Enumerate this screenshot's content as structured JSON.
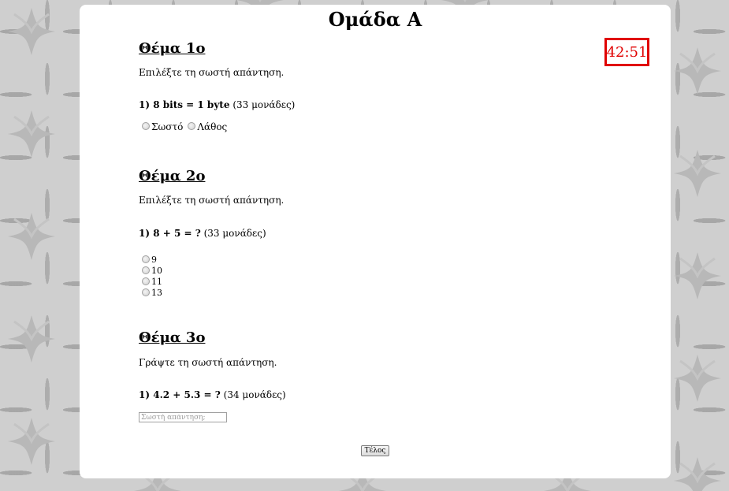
{
  "page": {
    "title": "Ομάδα Α"
  },
  "timer": {
    "value": "42:51",
    "color": "#e00000"
  },
  "sections": [
    {
      "heading": "Θέμα 1ο",
      "instruction": "Επιλέξτε τη σωστή απάντηση.",
      "question": {
        "number": "1)",
        "text": "8 bits = 1 byte",
        "points": "(33 μονάδες)"
      },
      "options": [
        "Σωστό",
        "Λάθος"
      ]
    },
    {
      "heading": "Θέμα 2ο",
      "instruction": "Επιλέξτε τη σωστή απάντηση.",
      "question": {
        "number": "1)",
        "text": "8 + 5 = ?",
        "points": "(33 μονάδες)"
      },
      "options": [
        "9",
        "10",
        "11",
        "13"
      ]
    },
    {
      "heading": "Θέμα 3ο",
      "instruction": "Γράψτε τη σωστή απάντηση.",
      "question": {
        "number": "1)",
        "text": "4.2 + 5.3 = ?",
        "points": "(34 μονάδες)"
      },
      "answer_placeholder": "Σωστή απάντηση;"
    }
  ],
  "finish_button": {
    "label": "Τέλος"
  },
  "colors": {
    "background": "#cfcfcf",
    "card": "#ffffff",
    "timer_border": "#e00000"
  }
}
